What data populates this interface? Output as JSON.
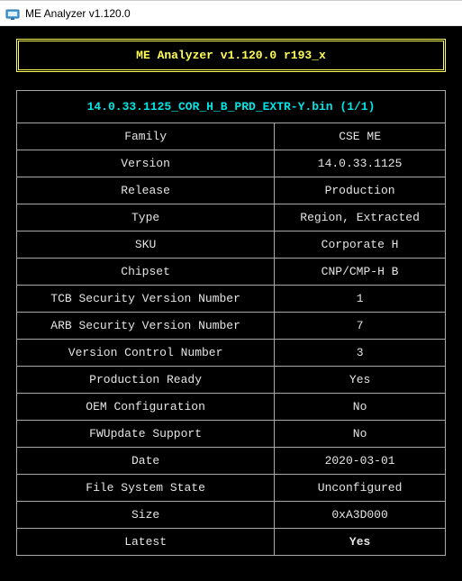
{
  "window": {
    "title": "ME Analyzer v1.120.0"
  },
  "banner": "ME Analyzer v1.120.0 r193_x",
  "file_header": "14.0.33.1125_COR_H_B_PRD_EXTR-Y.bin (1/1)",
  "rows": [
    {
      "label": "Family",
      "value": "CSE ME"
    },
    {
      "label": "Version",
      "value": "14.0.33.1125"
    },
    {
      "label": "Release",
      "value": "Production"
    },
    {
      "label": "Type",
      "value": "Region, Extracted"
    },
    {
      "label": "SKU",
      "value": "Corporate H"
    },
    {
      "label": "Chipset",
      "value": "CNP/CMP-H B"
    },
    {
      "label": "TCB Security Version Number",
      "value": "1"
    },
    {
      "label": "ARB Security Version Number",
      "value": "7"
    },
    {
      "label": "Version Control Number",
      "value": "3"
    },
    {
      "label": "Production Ready",
      "value": "Yes"
    },
    {
      "label": "OEM Configuration",
      "value": "No"
    },
    {
      "label": "FWUpdate Support",
      "value": "No"
    },
    {
      "label": "Date",
      "value": "2020-03-01"
    },
    {
      "label": "File System State",
      "value": "Unconfigured"
    },
    {
      "label": "Size",
      "value": "0xA3D000"
    },
    {
      "label": "Latest",
      "value": "Yes",
      "highlight": "green"
    }
  ]
}
